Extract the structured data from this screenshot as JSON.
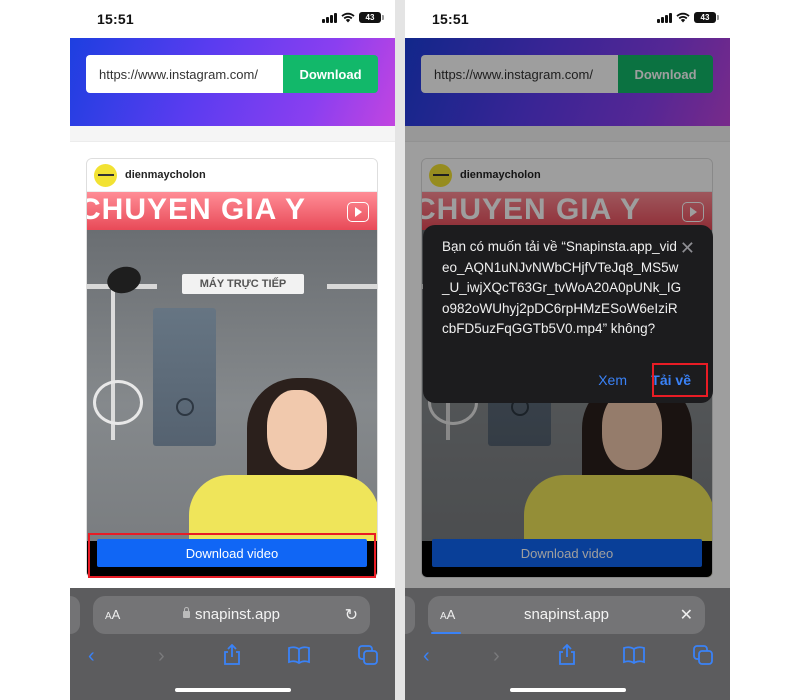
{
  "phones": [
    {
      "status_bar": {
        "time": "15:51",
        "battery": "43",
        "signal_icon": "cellular-signal-icon",
        "wifi_icon": "wifi-icon"
      },
      "url_form": {
        "value": "https://www.instagram.com/",
        "button_label": "Download"
      },
      "post": {
        "username": "dienmaycholon",
        "banner_text": "CHUYEN GIA Y",
        "sign_text": "MÁY TRỰC TIẾP",
        "download_video_label": "Download video"
      },
      "safari": {
        "text_size_label": "AA",
        "host": "snapinst.app",
        "right_icon": "reload-icon"
      }
    },
    {
      "status_bar": {
        "time": "15:51",
        "battery": "43",
        "signal_icon": "cellular-signal-icon",
        "wifi_icon": "wifi-icon"
      },
      "url_form": {
        "value": "https://www.instagram.com/",
        "button_label": "Download"
      },
      "post": {
        "username": "dienmaycholon",
        "banner_text": "CHUYEN GIA Y",
        "sign_text": "MÁY TRỰC TIẾP",
        "download_video_label": "Download video"
      },
      "dialog": {
        "message": "Bạn có muốn tải về “Snapinsta.app_video_AQN1uNJvNWbCHjfVTeJq8_MS5w_U_iwjXQcT63Gr_tvWoA20A0pUNk_IGo982oWUhyj2pDC6rpHMzESoW6eIziRcbFD5uzFqGGTb5V0.mp4” không?",
        "view_label": "Xem",
        "download_label": "Tải về"
      },
      "safari": {
        "text_size_label": "AA",
        "host": "snapinst.app",
        "right_icon": "close-icon"
      }
    }
  ],
  "colors": {
    "download_green": "#12b86a",
    "video_button_blue": "#1066f5",
    "highlight_red": "#e81c25",
    "ios_link_blue": "#3a82f7"
  }
}
